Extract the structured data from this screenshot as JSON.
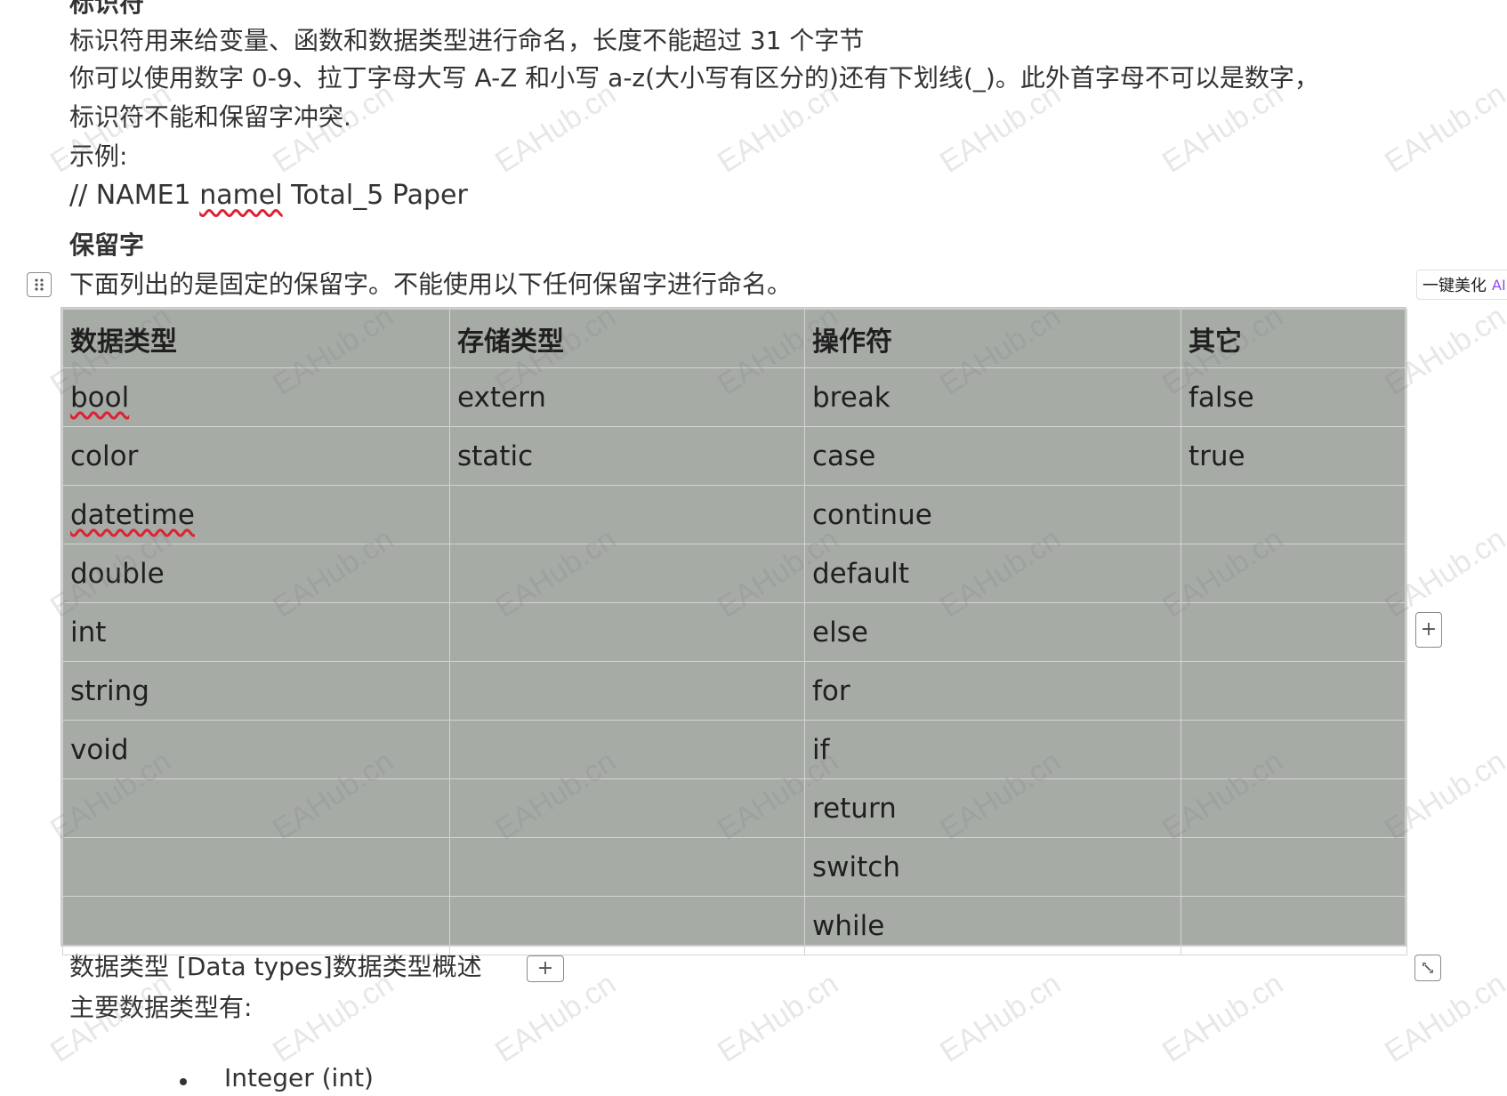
{
  "doc": {
    "heading_top": "标识符",
    "para1": "标识符用来给变量、函数和数据类型进行命名，长度不能超过 31 个字节",
    "para2": "你可以使用数字 0-9、拉丁字母大写 A-Z 和小写 a-z(大小写有区分的)还有下划线(_)。此外首字母不可以是数字，",
    "para3": "标识符不能和保留字冲突.",
    "example_label": "示例:",
    "code_prefix": "// NAME1 ",
    "code_squiggle": "namel",
    "code_suffix": " Total_5 Paper",
    "reserved_heading": "保留字",
    "reserved_intro": "下面列出的是固定的保留字。不能使用以下任何保留字进行命名。",
    "datatypes_heading": "数据类型  [Data types]数据类型概述",
    "main_types": "主要数据类型有:",
    "bullet_item": "Integer (int)"
  },
  "table": {
    "headers": [
      "数据类型",
      "存储类型",
      "操作符",
      "其它"
    ],
    "rows": [
      [
        "bool",
        "extern",
        "break",
        "false"
      ],
      [
        "color",
        "static",
        "case",
        "true"
      ],
      [
        "datetime",
        "",
        "continue",
        ""
      ],
      [
        "double",
        "",
        "default",
        ""
      ],
      [
        "int",
        "",
        "else",
        ""
      ],
      [
        "string",
        "",
        "for",
        ""
      ],
      [
        "void",
        "",
        "if",
        ""
      ],
      [
        "",
        "",
        "return",
        ""
      ],
      [
        "",
        "",
        "switch",
        ""
      ],
      [
        "",
        "",
        "while",
        ""
      ]
    ]
  },
  "controls": {
    "beautify_label": "一键美化",
    "beautify_ai": "AI",
    "add_symbol": "+"
  },
  "watermark": "EAHub.cn",
  "icons": [
    "drag-handle-icon",
    "plus-icon",
    "resize-icon"
  ]
}
